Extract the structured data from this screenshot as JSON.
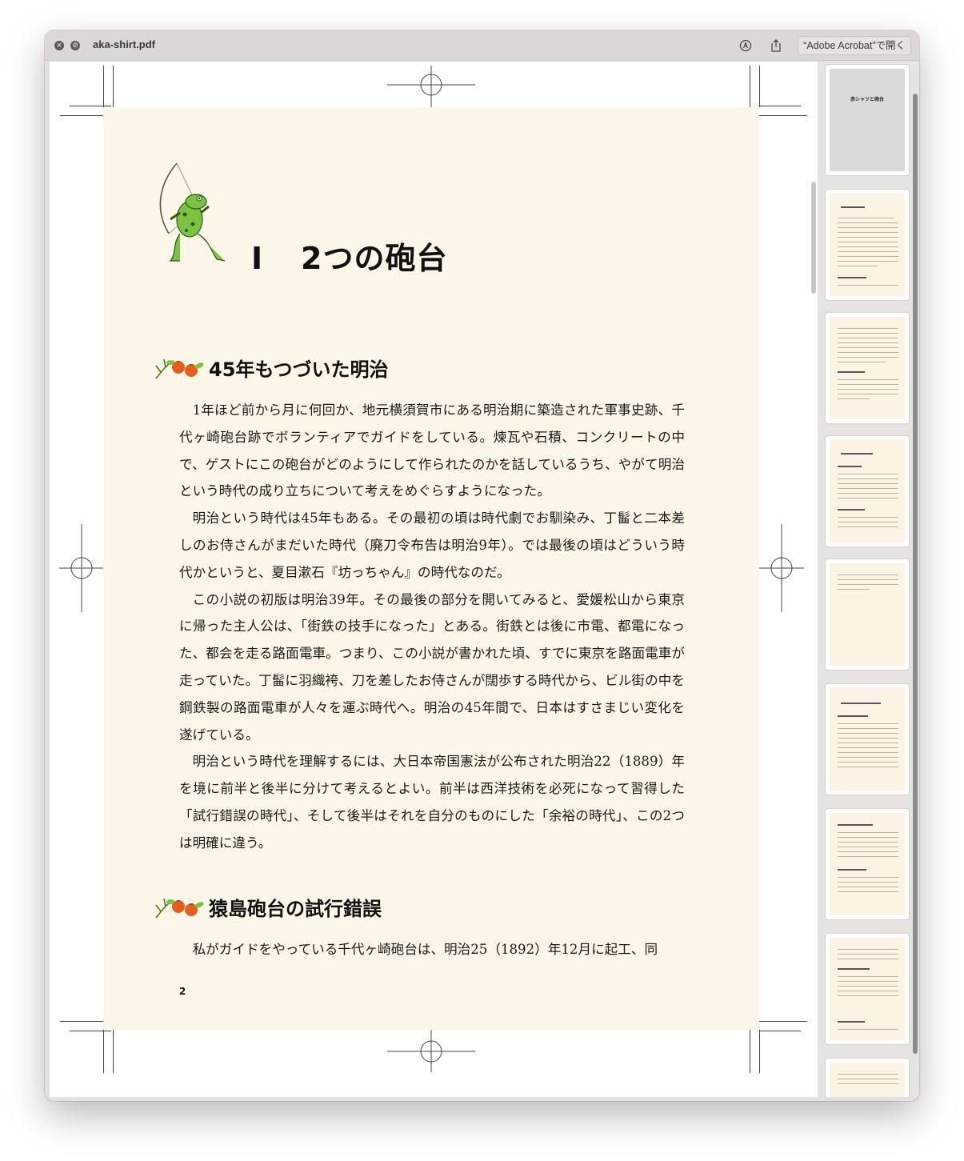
{
  "window": {
    "filename": "aka-shirt.pdf",
    "open_in_button": "“Adobe Acrobat”で開く"
  },
  "document": {
    "chapter_number": "Ⅰ",
    "chapter_title": "2つの砲台",
    "sections": [
      {
        "heading": "45年もつづいた明治",
        "paragraphs": [
          "1年ほど前から月に何回か、地元横須賀市にある明治期に築造された軍事史跡、千代ヶ崎砲台跡でボランティアでガイドをしている。煉瓦や石積、コンクリートの中で、ゲストにこの砲台がどのようにして作られたのかを話しているうち、やがて明治という時代の成り立ちについて考えをめぐらすようになった。",
          "明治という時代は45年もある。その最初の頃は時代劇でお馴染み、丁髷と二本差しのお侍さんがまだいた時代（廃刀令布告は明治9年）。では最後の頃はどういう時代かというと、夏目漱石『坊っちゃん』の時代なのだ。",
          "この小説の初版は明治39年。その最後の部分を開いてみると、愛媛松山から東京に帰った主人公は、「街鉄の技手になった」とある。街鉄とは後に市電、都電になった、都会を走る路面電車。つまり、この小説が書かれた頃、すでに東京を路面電車が走っていた。丁髷に羽織袴、刀を差したお侍さんが闊歩する時代から、ビル街の中を鋼鉄製の路面電車が人々を運ぶ時代へ。明治の45年間で、日本はすさまじい変化を遂げている。",
          "明治という時代を理解するには、大日本帝国憲法が公布された明治22（1889）年を境に前半と後半に分けて考えるとよい。前半は西洋技術を必死になって習得した「試行錯誤の時代」、そして後半はそれを自分のものにした「余裕の時代」、この2つは明確に違う。"
        ]
      },
      {
        "heading": "猿島砲台の試行錯誤",
        "paragraphs": [
          "私がガイドをやっている千代ヶ崎砲台は、明治25（1892）年12月に起工、同"
        ]
      }
    ],
    "page_number": "2"
  },
  "thumbnails": {
    "cover_title": "赤シャツと砲台"
  },
  "colors": {
    "page_background": "#fcf6e8",
    "window_chrome": "#dcd7d7",
    "frog_green": "#7cc242",
    "orange": "#e85d1e"
  }
}
